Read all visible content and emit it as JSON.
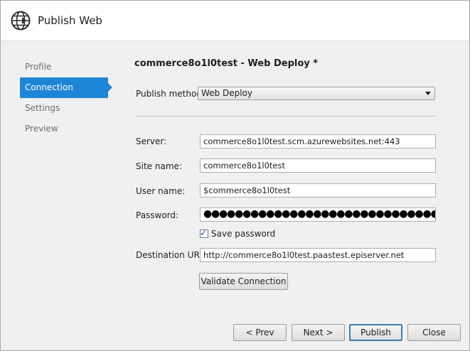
{
  "window": {
    "title": "Publish Web",
    "icon": "globe-publish-icon"
  },
  "nav": {
    "items": [
      {
        "label": "Profile",
        "active": false
      },
      {
        "label": "Connection",
        "active": true
      },
      {
        "label": "Settings",
        "active": false
      },
      {
        "label": "Preview",
        "active": false
      }
    ]
  },
  "main": {
    "heading": "commerce8o1l0test - Web Deploy *",
    "publish_method_label": "Publish method:",
    "publish_method_value": "Web Deploy",
    "server_label": "Server:",
    "server_value": "commerce8o1l0test.scm.azurewebsites.net:443",
    "site_name_label": "Site name:",
    "site_name_value": "commerce8o1l0test",
    "user_name_label": "User name:",
    "user_name_value": "$commerce8o1l0test",
    "password_label": "Password:",
    "password_value": "●●●●●●●●●●●●●●●●●●●●●●●●●●●●●●●●●●●●●●●●●●●●●●●●●●●",
    "save_password_label": "Save password",
    "save_password_checked": true,
    "destination_url_label": "Destination URL:",
    "destination_url_value": "http://commerce8o1l0test.paastest.episerver.net",
    "validate_button": "Validate Connection"
  },
  "footer": {
    "prev": "< Prev",
    "next": "Next >",
    "publish": "Publish",
    "close": "Close"
  },
  "colors": {
    "accent": "#1e86d6",
    "panel_bg": "#f0f0f0"
  }
}
